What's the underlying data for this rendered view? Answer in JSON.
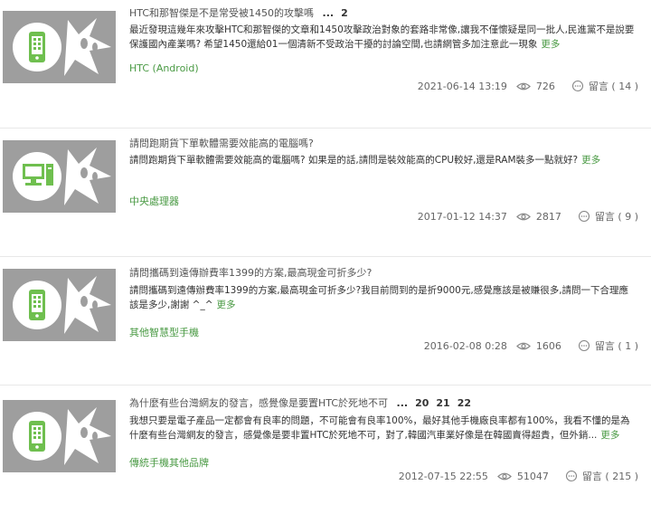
{
  "posts": [
    {
      "title": "HTC和那智傑是不是常受被1450的攻擊嗎",
      "pages": [
        "...",
        "2"
      ],
      "excerpt": "最近發現這幾年來攻擊HTC和那智傑的文章和1450攻擊政治對象的套路非常像,讓我不僅懷疑是同一批人,民進黨不是說要保護國內產業嗎? 希望1450還給01一個清新不受政治干擾的討論空間,也請網管多加注意此一現象",
      "more": "更多",
      "category": "HTC (Android)",
      "date": "2021-06-14 13:19",
      "views": "726",
      "comments": "留言 ( 14 )",
      "icon": "phone-icon"
    },
    {
      "title": "請問跑期貨下單軟體需要效能高的電腦嗎?",
      "pages": [],
      "excerpt": "請問跑期貨下單軟體需要效能高的電腦嗎? 如果是的話,請問是裝效能高的CPU較好,還是RAM裝多一點就好?",
      "more": "更多",
      "category": "中央處理器",
      "date": "2017-01-12 14:37",
      "views": "2817",
      "comments": "留言 ( 9 )",
      "icon": "desktop-computer-icon"
    },
    {
      "title": "請問攜碼到遠傳辦費率1399的方案,最高現金可折多少?",
      "pages": [],
      "excerpt": "請問攜碼到遠傳辦費率1399的方案,最高現金可折多少?我目前問到的是折9000元,感覺應該是被賺很多,請問一下合理應該是多少,謝謝 ^_^",
      "more": "更多",
      "category": "其他智慧型手機",
      "date": "2016-02-08 0:28",
      "views": "1606",
      "comments": "留言 ( 1 )",
      "icon": "phone-icon"
    },
    {
      "title": "為什麼有些台灣網友的發言，感覺像是要置HTC於死地不可",
      "pages": [
        "...",
        "20",
        "21",
        "22"
      ],
      "excerpt": "我想只要是電子產品一定都會有良率的問題，不可能會有良率100%，最好其他手機廠良率都有100%，我看不懂的是為什麼有些台灣網友的發言，感覺像是要非置HTC於死地不可，對了,韓國汽車業好像是在韓國賣得超貴，但外銷...",
      "more": "更多",
      "category": "傳統手機其他品牌",
      "date": "2012-07-15 22:55",
      "views": "51047",
      "comments": "留言 ( 215 )",
      "icon": "phone-icon"
    }
  ],
  "colors": {
    "accent": "#4a9a44",
    "icon_green": "#6fbf4f",
    "thumb_bg": "#9e9e9e"
  }
}
